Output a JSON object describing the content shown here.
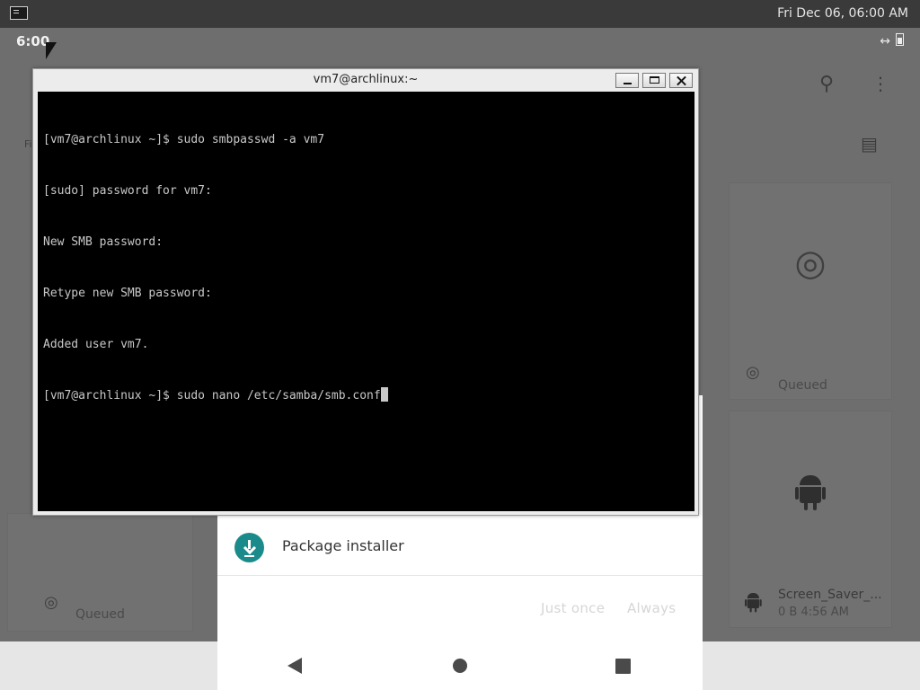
{
  "desktop_panel": {
    "clock": "Fri Dec 06, 06:00 AM",
    "launcher_icon": "terminal-icon"
  },
  "android": {
    "status_time": "6:00",
    "status_icons": [
      "data-transfer-icon",
      "battery-icon"
    ],
    "left_label_fragment": "Fi",
    "cards": [
      {
        "caption": "Queued",
        "icon": "fingerprint-icon"
      },
      {
        "caption": "Queued",
        "icon": "fingerprint-icon"
      },
      {
        "caption": "Screen_Saver_...",
        "sub": "0 B  4:56 AM",
        "icon": "android-icon"
      }
    ]
  },
  "terminal": {
    "title": "vm7@archlinux:~",
    "lines": [
      "[vm7@archlinux ~]$ sudo smbpasswd -a vm7",
      "[sudo] password for vm7:",
      "New SMB password:",
      "Retype new SMB password:",
      "Added user vm7.",
      "[vm7@archlinux ~]$ sudo nano /etc/samba/smb.conf"
    ]
  },
  "chooser": {
    "app_label": "Package installer",
    "just_once": "Just once",
    "always": "Always"
  }
}
